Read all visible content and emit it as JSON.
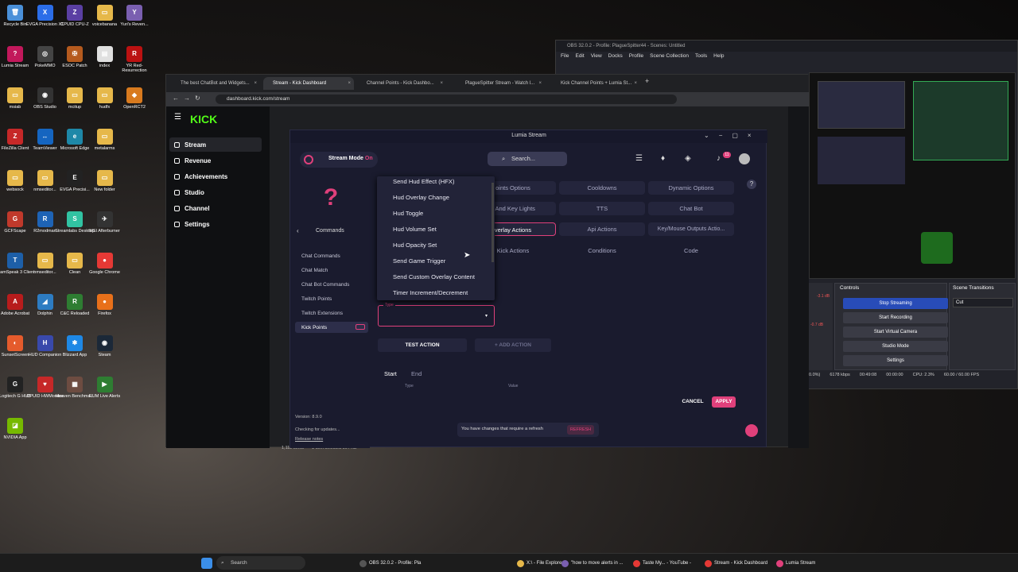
{
  "desktop_icons": [
    {
      "label": "Recycle Bin",
      "color": "#4a90d9",
      "g": "🗑"
    },
    {
      "label": "EVGA Precision X1",
      "color": "#2b6de8",
      "g": "X"
    },
    {
      "label": "CPUID CPU-Z",
      "color": "#5a3fa3",
      "g": "Z"
    },
    {
      "label": "voicebanana",
      "color": "#e6b84a",
      "g": "▭"
    },
    {
      "label": "Yuri's Reven...",
      "color": "#7a5fb0",
      "g": "Y"
    },
    {
      "label": "Lumia Stream",
      "color": "#c2185b",
      "g": "?"
    },
    {
      "label": "PokeMMO",
      "color": "#444",
      "g": "◎"
    },
    {
      "label": "ESOC Patch",
      "color": "#b55a1e",
      "g": "✠"
    },
    {
      "label": "index",
      "color": "#e0e0e0",
      "g": "▤"
    },
    {
      "label": "YR Red-Resurrection",
      "color": "#b11",
      "g": "R"
    },
    {
      "label": "msiab",
      "color": "#e6b84a",
      "g": "▭"
    },
    {
      "label": "OBS Studio",
      "color": "#333",
      "g": "◉"
    },
    {
      "label": "mcitup",
      "color": "#e6b84a",
      "g": "▭"
    },
    {
      "label": "hudfx",
      "color": "#e6b84a",
      "g": "▭"
    },
    {
      "label": "OpenRCT2",
      "color": "#d87a1e",
      "g": "◆"
    },
    {
      "label": "FileZilla Client",
      "color": "#c62828",
      "g": "Z"
    },
    {
      "label": "TeamViewer",
      "color": "#1565c0",
      "g": "↔"
    },
    {
      "label": "Microsoft Edge",
      "color": "#1e88a8",
      "g": "e"
    },
    {
      "label": "metalarms",
      "color": "#e6b84a",
      "g": "▭"
    },
    {
      "label": "websock",
      "color": "#e6b84a",
      "g": "▭"
    },
    {
      "label": "nmseditor...",
      "color": "#e6b84a",
      "g": "▭"
    },
    {
      "label": "EVGA Precisi...",
      "color": "#222",
      "g": "E"
    },
    {
      "label": "New folder",
      "color": "#e6b84a",
      "g": "▭"
    },
    {
      "label": "GCFScape",
      "color": "#c0392b",
      "g": "G"
    },
    {
      "label": "R2modman",
      "color": "#1e63b5",
      "g": "R"
    },
    {
      "label": "Streamlabs Desktop",
      "color": "#31c3a2",
      "g": "S"
    },
    {
      "label": "MSI Afterburner",
      "color": "#333",
      "g": "✈"
    },
    {
      "label": "TeamSpeak 3 Client",
      "color": "#1d5fa8",
      "g": "T"
    },
    {
      "label": "nmseditor...",
      "color": "#e6b84a",
      "g": "▭"
    },
    {
      "label": "Clean",
      "color": "#e6b84a",
      "g": "▭"
    },
    {
      "label": "Google Chrome",
      "color": "#e53935",
      "g": "●"
    },
    {
      "label": "Adobe Acrobat",
      "color": "#b71c1c",
      "g": "A"
    },
    {
      "label": "Dolphin",
      "color": "#2d7cc2",
      "g": "◢"
    },
    {
      "label": "C&C Reloaded",
      "color": "#2e7d32",
      "g": "R"
    },
    {
      "label": "Firefox",
      "color": "#e8701a",
      "g": "●"
    },
    {
      "label": "SunsetScreen",
      "color": "#e55b2c",
      "g": "◐"
    },
    {
      "label": "HUD Companion",
      "color": "#3949ab",
      "g": "H"
    },
    {
      "label": "Blizzard App",
      "color": "#1e88e5",
      "g": "✱"
    },
    {
      "label": "Steam",
      "color": "#1b2838",
      "g": "◉"
    },
    {
      "label": "Logitech G HUB",
      "color": "#222",
      "g": "G"
    },
    {
      "label": "CPUID HWMonitor",
      "color": "#c62828",
      "g": "♥"
    },
    {
      "label": "Heaven Benchma...",
      "color": "#6d4c41",
      "g": "▦"
    },
    {
      "label": "RUM Live Alerts",
      "color": "#2e7d32",
      "g": "▶"
    },
    {
      "label": "NVIDIA App",
      "color": "#76b900",
      "g": "◪"
    }
  ],
  "obs": {
    "title": "OBS 32.0.2 - Profile: PlagueSpitter44 - Scenes: Untitled",
    "menu": [
      "File",
      "Edit",
      "View",
      "Docks",
      "Profile",
      "Scene Collection",
      "Tools",
      "Help"
    ],
    "controls_title": "Controls",
    "transitions_title": "Scene Transitions",
    "buttons": [
      "Stop Streaming",
      "Start Recording",
      "Start Virtual Camera",
      "Studio Mode",
      "Settings"
    ],
    "transition": "Cut",
    "status": [
      "0.0%)",
      "6178 kbps",
      "00:49:08",
      "00:00:00",
      "CPU: 2.3%",
      "60.00 / 60.00 FPS"
    ],
    "db": [
      "-3.1 dB",
      "-0.7 dB"
    ]
  },
  "chrome": {
    "tabs": [
      "The best ChatBot and Widgets...",
      "Stream - Kick Dashboard",
      "Channel Points - Kick Dashbo...",
      "PlagueSpitter Stream - Watch l...",
      "Kick Channel Points + Lumia St..."
    ],
    "url": "dashboard.kick.com/stream",
    "logo": "KICK",
    "side": [
      "Stream",
      "Revenue",
      "Achievements",
      "Studio",
      "Channel",
      "Settings"
    ],
    "file_status": [
      "1,112 items",
      "1 item selected 164 KB"
    ]
  },
  "lumia": {
    "title": "Lumia Stream",
    "mode_label": "Stream Mode",
    "mode_state": "On",
    "search": "Search...",
    "notif_count": "11",
    "back_label": "Commands",
    "side_items": [
      "Chat Commands",
      "Chat Match",
      "Chat Bot Commands",
      "Twitch Points",
      "Twitch Extensions",
      "Kick Points"
    ],
    "version": "Version: 8.9.0",
    "checking": "Checking for updates...",
    "release": "Release notes",
    "categories": [
      "oints Options",
      "Cooldowns",
      "Dynamic Options",
      "s And Key Lights",
      "TTS",
      "Chat Bot",
      "verlay Actions",
      "Api Actions",
      "Key/Mouse Outputs Actio...",
      "Kick Actions",
      "Conditions",
      "Code"
    ],
    "dropdown": [
      "Send Hud Effect (HFX)",
      "Hud Overlay Change",
      "Hud Toggle",
      "Hud Volume Set",
      "Hud Opacity Set",
      "Send Game Trigger",
      "Send Custom Overlay Content",
      "Timer Increment/Decrement"
    ],
    "type_label": "Type",
    "test_action": "TEST ACTION",
    "add_action": "ADD ACTION",
    "start_tab": "Start",
    "end_tab": "End",
    "col_type": "Type",
    "col_value": "Value",
    "cancel": "CANCEL",
    "apply": "APPLY",
    "notice": "You have changes that require a refresh",
    "refresh": "REFRESH"
  },
  "taskbar": {
    "search": "Search",
    "apps": [
      "OBS 32.0.2 - Profile: Pla",
      "X:\\ - File Explorer",
      "\"how to move alerts in ...",
      "Taste My... - YouTube -",
      "Stream - Kick Dashboard",
      "Lumia Stream"
    ]
  },
  "colors": {
    "accent": "#e0407b",
    "kick": "#53fc18",
    "obs_active": "#284cb8"
  }
}
